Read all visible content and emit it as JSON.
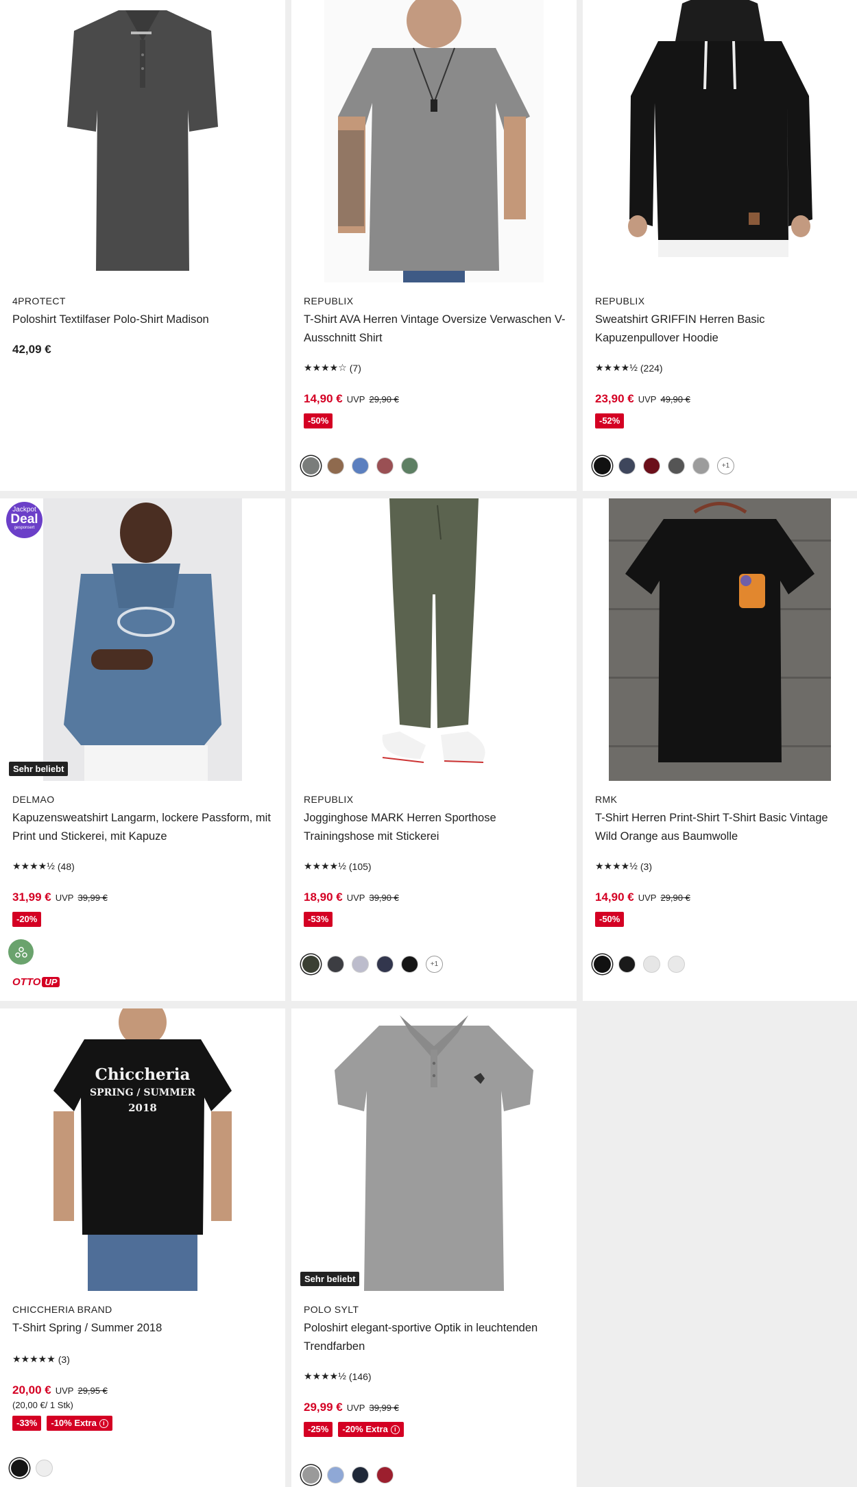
{
  "products": [
    {
      "brand": "4PROTECT",
      "title": "Poloshirt Textilfaser Polo-Shirt Madison",
      "price": "42,09 €",
      "swatches": []
    },
    {
      "brand": "REPUBLIX",
      "title": "T-Shirt AVA Herren Vintage Oversize Verwaschen V-Ausschnitt Shirt",
      "stars": "★★★★☆",
      "rating_count": "(7)",
      "rating": 4,
      "price": "14,90 €",
      "uvp_label": "UVP",
      "uvp_price": "29,90 €",
      "badges": [
        "-50%"
      ],
      "swatches": [
        "#7a7d7b",
        "#8f6a4e",
        "#5b7fbf",
        "#9a5054",
        "#5d7f63"
      ]
    },
    {
      "brand": "REPUBLIX",
      "title": "Sweatshirt GRIFFIN Herren Basic Kapuzenpullover Hoodie",
      "stars": "★★★★½",
      "rating_count": "(224)",
      "rating": 4.5,
      "price": "23,90 €",
      "uvp_label": "UVP",
      "uvp_price": "49,90 €",
      "badges": [
        "-52%"
      ],
      "swatches": [
        "#111111",
        "#3e465c",
        "#6b0f1a",
        "#555555",
        "#9c9c9c"
      ],
      "more_label": "+1"
    },
    {
      "brand": "DELMAO",
      "title": "Kapuzensweatshirt Langarm, lockere Passform, mit Print und Stickerei, mit Kapuze",
      "stars": "★★★★½",
      "rating_count": "(48)",
      "rating": 4.5,
      "price": "31,99 €",
      "uvp_label": "UVP",
      "uvp_price": "39,99 €",
      "badges": [
        "-20%"
      ],
      "tag": "Sehr beliebt",
      "jackpot": {
        "line1": "Jackpot",
        "line2": "Deal",
        "line3": "gesponsert"
      },
      "ottoup": {
        "otto": "OTTO",
        "up": "UP"
      },
      "swatches": []
    },
    {
      "brand": "REPUBLIX",
      "title": "Jogginghose MARK Herren Sporthose Trainingshose mit Stickerei",
      "stars": "★★★★½",
      "rating_count": "(105)",
      "rating": 4.5,
      "price": "18,90 €",
      "uvp_label": "UVP",
      "uvp_price": "39,90 €",
      "badges": [
        "-53%"
      ],
      "swatches": [
        "#3a3f33",
        "#3c3d42",
        "#bcbccc",
        "#32364d",
        "#151515"
      ],
      "more_label": "+1"
    },
    {
      "brand": "RMK",
      "title": "T-Shirt Herren Print-Shirt T-Shirt Basic Vintage Wild Orange aus Baumwolle",
      "stars": "★★★★½",
      "rating_count": "(3)",
      "rating": 4.5,
      "price": "14,90 €",
      "uvp_label": "UVP",
      "uvp_price": "29,90 €",
      "badges": [
        "-50%"
      ],
      "swatches": [
        "#111111",
        "#1a1a1a",
        "#e6e6e6",
        "#e9e9e9"
      ]
    },
    {
      "brand": "CHICCHERIA BRAND",
      "title": "T-Shirt Spring / Summer 2018",
      "stars": "★★★★★",
      "rating_count": "(3)",
      "rating": 5,
      "price": "20,00 €",
      "uvp_label": "UVP",
      "uvp_price": "29,95 €",
      "unit_price": "(20,00 €/ 1 Stk)",
      "badges": [
        "-33%",
        "-10% Extra"
      ],
      "swatches": [
        "#151515",
        "#eeeeee"
      ],
      "print": {
        "line1": "Chiccheria",
        "line2": "SPRING / SUMMER",
        "line3": "2018"
      }
    },
    {
      "brand": "POLO SYLT",
      "title": "Poloshirt elegant-sportive Optik in leuchtenden Trendfarben",
      "stars": "★★★★½",
      "rating_count": "(146)",
      "rating": 4.5,
      "price": "29,99 €",
      "uvp_label": "UVP",
      "uvp_price": "39,99 €",
      "badges": [
        "-25%",
        "-20% Extra"
      ],
      "tag": "Sehr beliebt",
      "swatches": [
        "#9a9a9a",
        "#8fa8d6",
        "#1f2838",
        "#9c1f2e"
      ]
    }
  ],
  "info_icon_glyph": "i",
  "colors": {
    "sale_red": "#d40023",
    "text": "#222222",
    "background": "#eeeeee",
    "card": "#ffffff"
  }
}
